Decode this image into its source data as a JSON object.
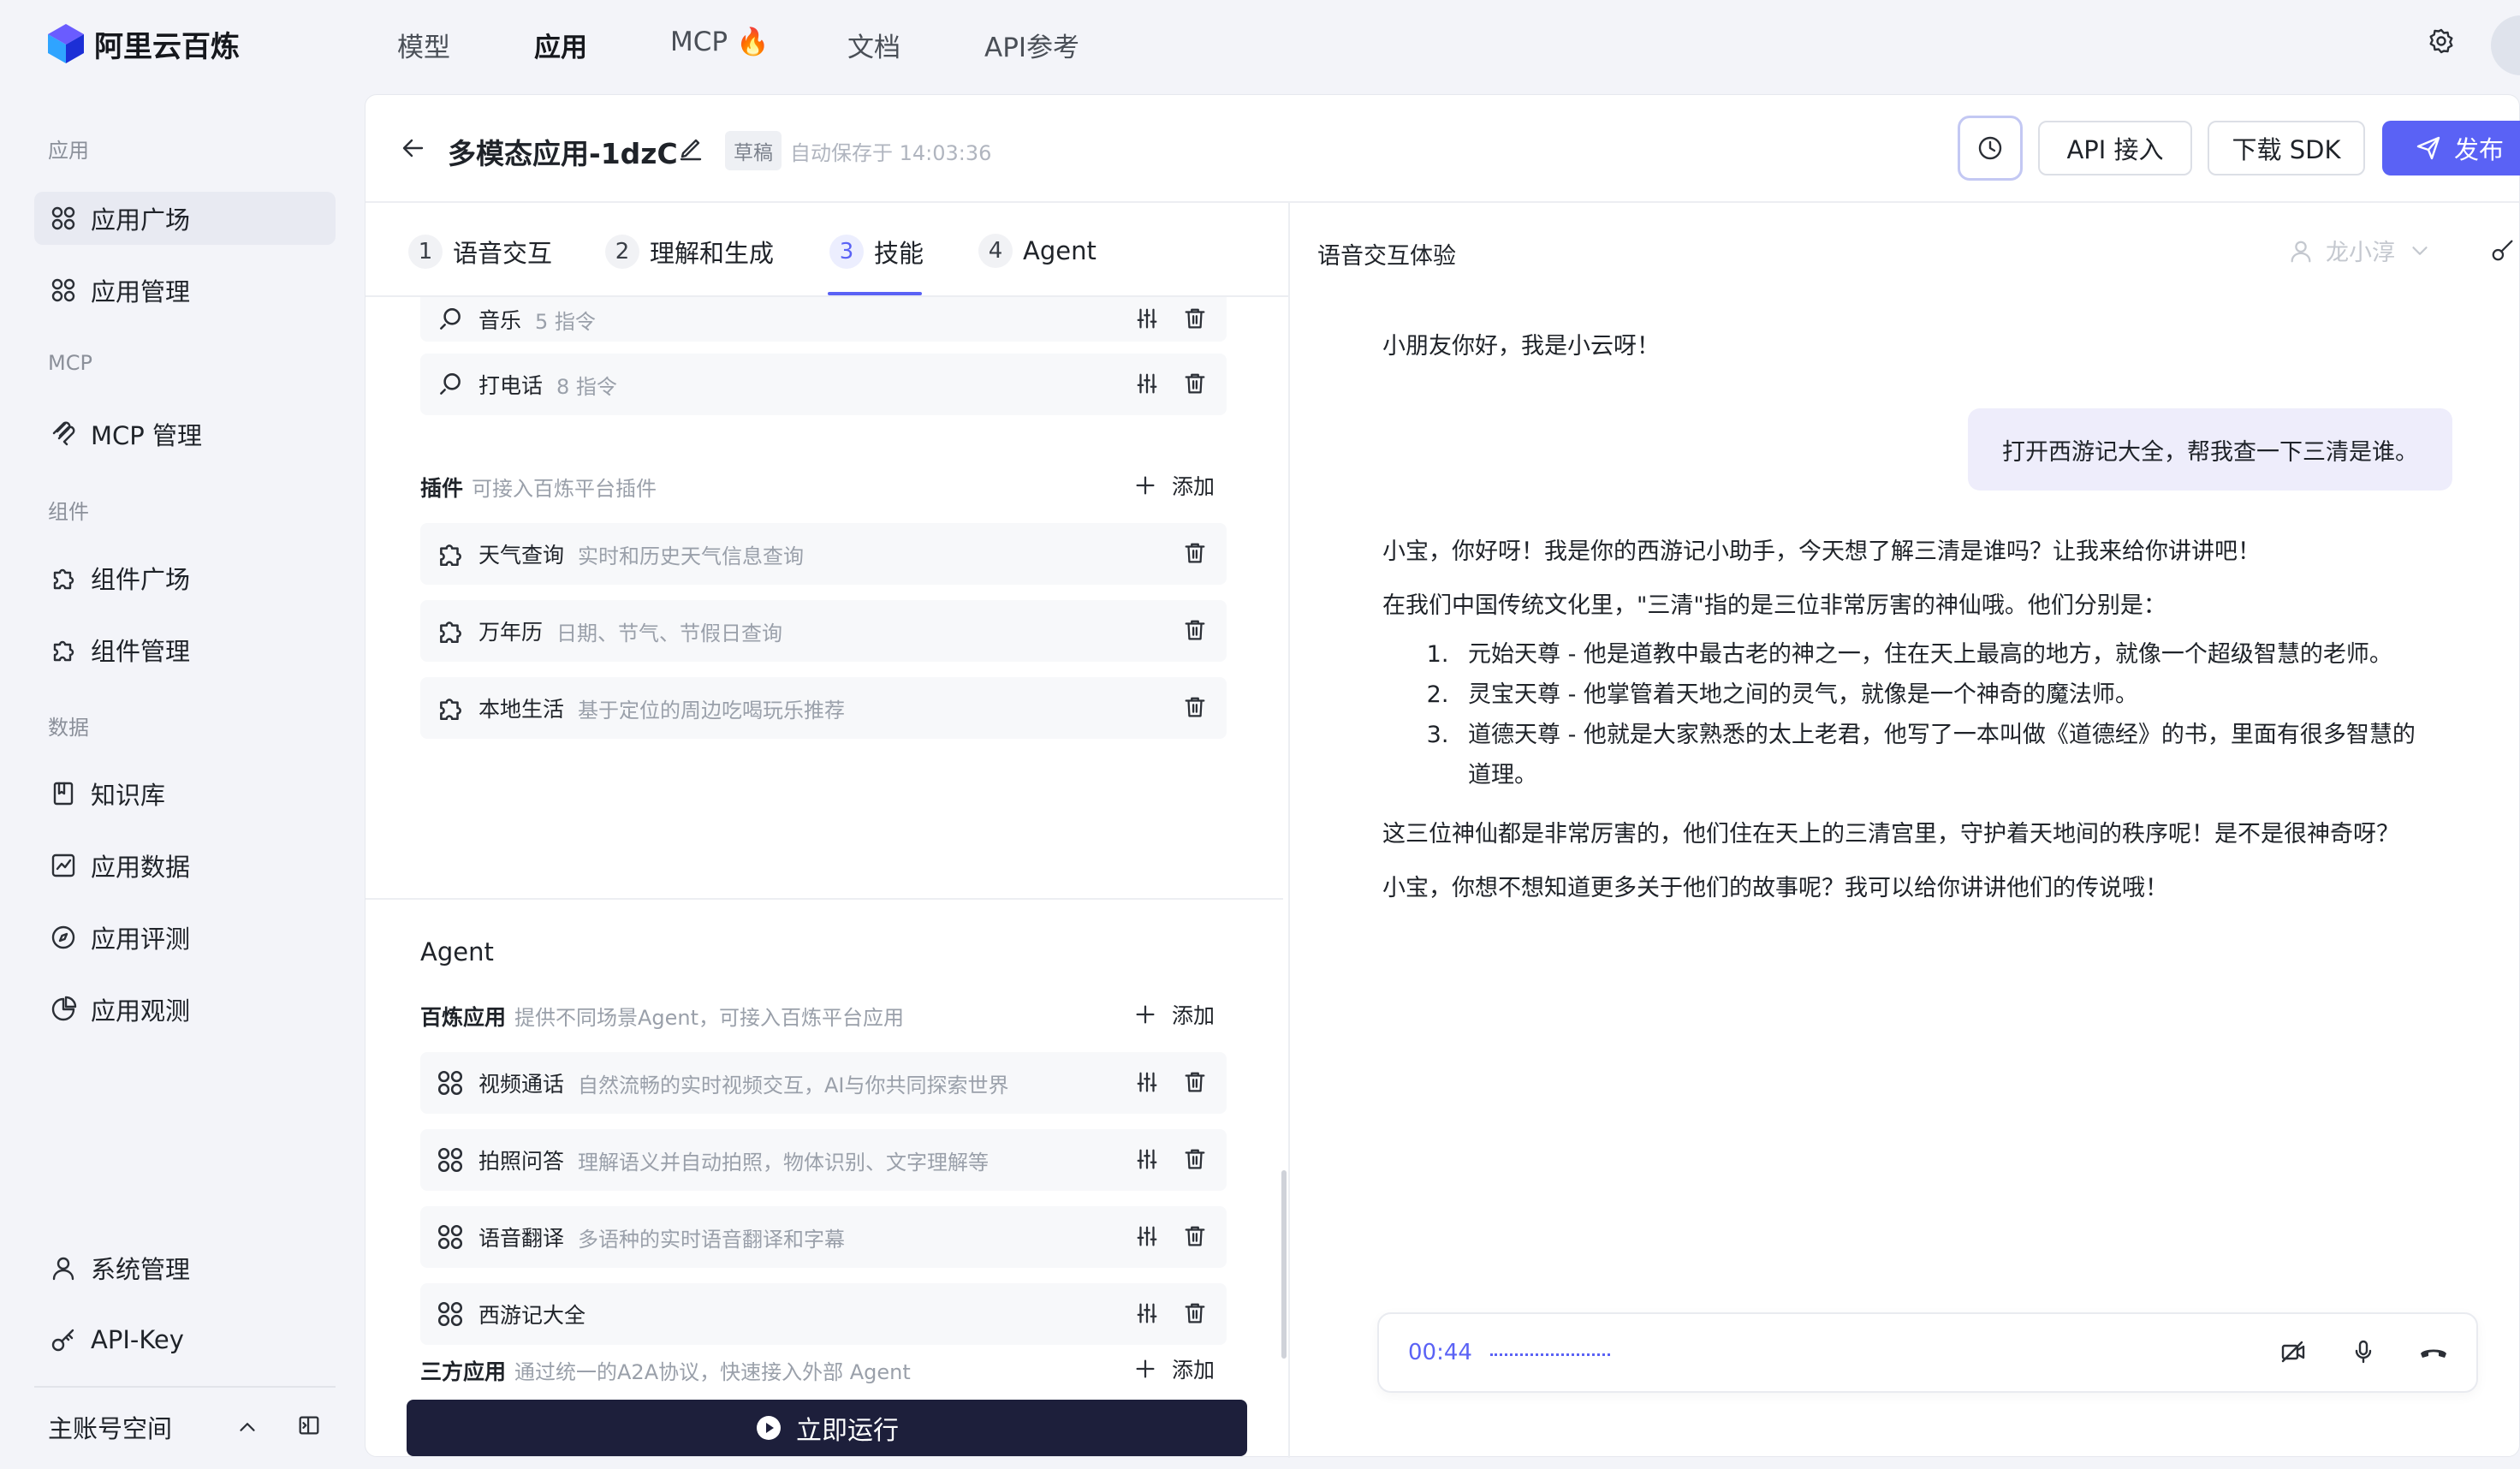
{
  "brand": {
    "name": "阿里云百炼"
  },
  "nav": [
    {
      "label": "模型"
    },
    {
      "label": "应用"
    },
    {
      "label": "MCP 🔥"
    },
    {
      "label": "文档"
    },
    {
      "label": "API参考"
    }
  ],
  "sidebar": {
    "sections": {
      "app": "应用",
      "mcp": "MCP",
      "component": "组件",
      "data": "数据"
    },
    "items": [
      {
        "label": "应用广场",
        "icon": "grid-icon"
      },
      {
        "label": "应用管理",
        "icon": "grid-icon"
      },
      {
        "label": "MCP 管理",
        "icon": "mcp-icon"
      },
      {
        "label": "组件广场",
        "icon": "puzzle-icon"
      },
      {
        "label": "组件管理",
        "icon": "puzzle-icon"
      },
      {
        "label": "知识库",
        "icon": "book-icon"
      },
      {
        "label": "应用数据",
        "icon": "chart-icon"
      },
      {
        "label": "应用评测",
        "icon": "compass-icon"
      },
      {
        "label": "应用观测",
        "icon": "pie-icon"
      },
      {
        "label": "系统管理",
        "icon": "user-icon"
      },
      {
        "label": "API-Key",
        "icon": "key-icon"
      }
    ],
    "account": "主账号空间"
  },
  "header": {
    "title": "多模态应用-1dzC",
    "draft": "草稿",
    "autosave": "自动保存于 14:03:36",
    "api_btn": "API 接入",
    "sdk_btn": "下载 SDK",
    "publish_btn": "发布"
  },
  "steps": [
    {
      "num": "1",
      "label": "语音交互"
    },
    {
      "num": "2",
      "label": "理解和生成"
    },
    {
      "num": "3",
      "label": "技能"
    },
    {
      "num": "4",
      "label": "Agent"
    }
  ],
  "active_step": "3",
  "skills": [
    {
      "name": "音乐",
      "desc": "5 指令"
    },
    {
      "name": "打电话",
      "desc": "8 指令"
    }
  ],
  "plugins": {
    "title": "插件",
    "desc": "可接入百炼平台插件",
    "add": "添加",
    "items": [
      {
        "name": "天气查询",
        "desc": "实时和历史天气信息查询"
      },
      {
        "name": "万年历",
        "desc": "日期、节气、节假日查询"
      },
      {
        "name": "本地生活",
        "desc": "基于定位的周边吃喝玩乐推荐"
      }
    ]
  },
  "agent": {
    "title": "Agent",
    "bailian": {
      "title": "百炼应用",
      "desc": "提供不同场景Agent，可接入百炼平台应用",
      "add": "添加",
      "items": [
        {
          "name": "视频通话",
          "desc": "自然流畅的实时视频交互，AI与你共同探索世界"
        },
        {
          "name": "拍照问答",
          "desc": "理解语义并自动拍照，物体识别、文字理解等"
        },
        {
          "name": "语音翻译",
          "desc": "多语种的实时语音翻译和字幕"
        },
        {
          "name": "西游记大全",
          "desc": ""
        }
      ]
    },
    "third": {
      "title": "三方应用",
      "desc": "通过统一的A2A协议，快速接入外部 Agent",
      "add": "添加"
    }
  },
  "run_btn": "立即运行",
  "chat": {
    "title": "语音交互体验",
    "voice": "龙小淳",
    "greeting": "小朋友你好，我是小云呀！",
    "user_msg": "打开西游记大全，帮我查一下三清是谁。",
    "reply_p1": "小宝，你好呀！我是你的西游记小助手，今天想了解三清是谁吗？让我来给你讲讲吧！",
    "reply_p2": "在我们中国传统文化里，\"三清\"指的是三位非常厉害的神仙哦。他们分别是：",
    "reply_list": [
      "元始天尊 - 他是道教中最古老的神之一，住在天上最高的地方，就像一个超级智慧的老师。",
      "灵宝天尊 - 他掌管着天地之间的灵气，就像是一个神奇的魔法师。",
      "道德天尊 - 他就是大家熟悉的太上老君，他写了一本叫做《道德经》的书，里面有很多智慧的道理。"
    ],
    "reply_p3": "这三位神仙都是非常厉害的，他们住在天上的三清宫里，守护着天地间的秩序呢！是不是很神奇呀？",
    "reply_p4": "小宝，你想不想知道更多关于他们的故事呢？我可以给你讲讲他们的传说哦！",
    "timer": "00:44"
  },
  "colors": {
    "accent": "#5a62f5",
    "run": "#1d1f3b",
    "bubble": "#eeedfb"
  }
}
